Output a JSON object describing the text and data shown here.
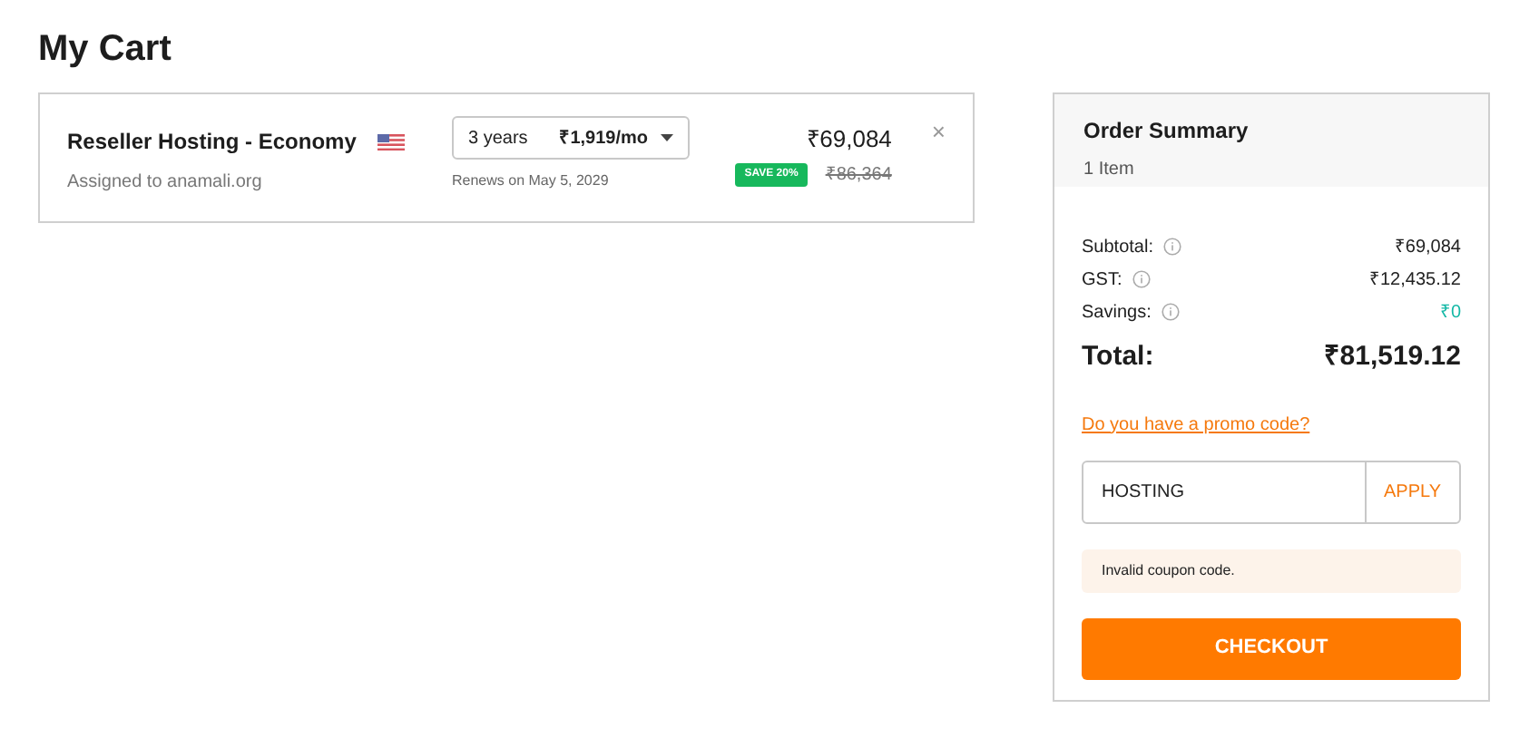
{
  "page_title": "My Cart",
  "cart_items": [
    {
      "name": "Reseller Hosting - Economy",
      "assigned": "Assigned to anamali.org",
      "term": "3 years",
      "monthly": "₹1,919/mo",
      "renews": "Renews on May 5, 2029",
      "price": "₹69,084",
      "badge": "SAVE 20%",
      "old_price": "₹86,364",
      "remove": "×"
    }
  ],
  "summary": {
    "title": "Order Summary",
    "count": "1 Item",
    "rows": [
      {
        "label": "Subtotal:",
        "value": "₹69,084",
        "kind": "amount"
      },
      {
        "label": "GST:",
        "value": "₹12,435.12",
        "kind": "amount"
      },
      {
        "label": "Savings:",
        "value": "₹0",
        "kind": "savings"
      }
    ],
    "total_label": "Total:",
    "total_value": "₹81,519.12",
    "promo_link": "Do you have a promo code?",
    "promo_field": {
      "value": "HOSTING"
    },
    "apply_button": "APPLY",
    "error": "Invalid coupon code.",
    "checkout_button": "CHECKOUT"
  }
}
